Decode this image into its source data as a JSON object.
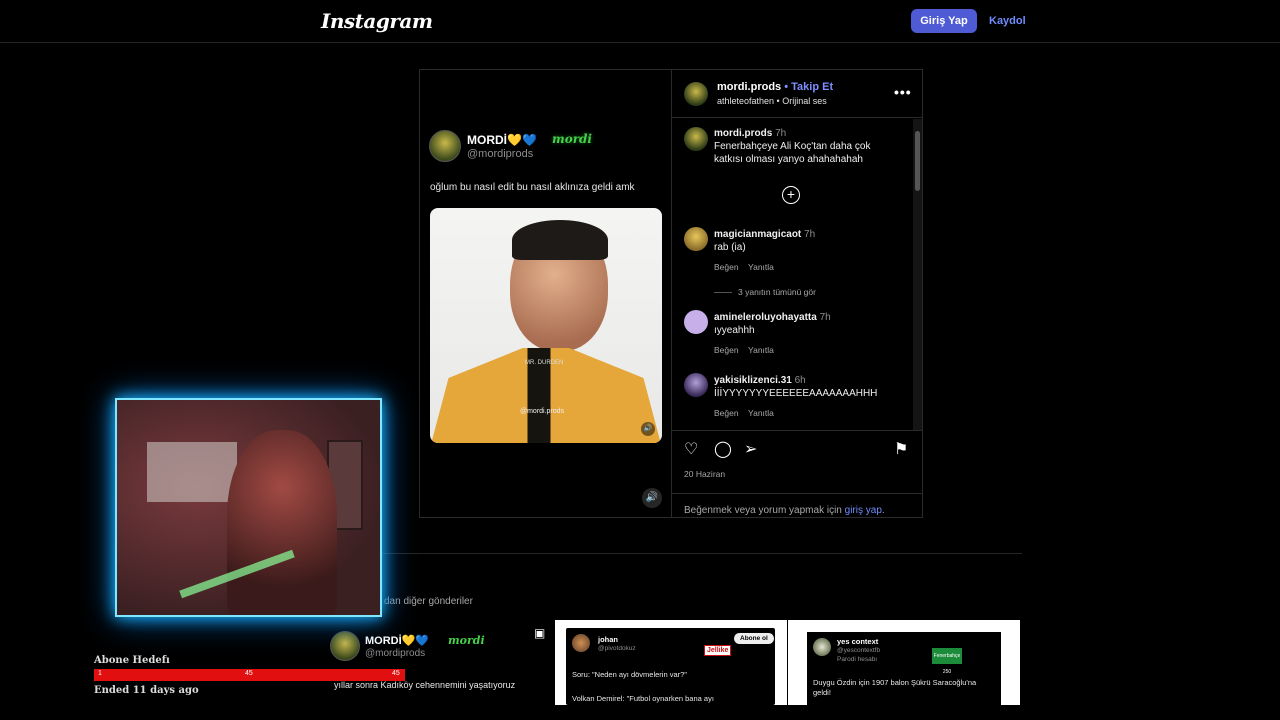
{
  "header": {
    "logo": "Instagram",
    "login_label": "Giriş Yap",
    "signup_label": "Kaydol"
  },
  "post": {
    "media": {
      "tweet_name": "MORDİ💛💙",
      "tweet_handle": "@mordiprods",
      "tweet_text": "oğlum bu nasıl edit bu nasıl aklınıza geldi amk",
      "video_tag": "MR. DURDEN",
      "video_watermark": "@mordi.prods",
      "badge": "mordi"
    },
    "author": {
      "username": "mordi.prods",
      "follow_label": "• Takip Et",
      "subline": "athleteofathen • Orijinal ses"
    },
    "caption": {
      "username": "mordi.prods",
      "time": "7h",
      "text": "Fenerbahçeye Ali Koç'tan daha çok katkısı olması yanyo ahahahahah"
    },
    "comments": [
      {
        "username": "magicianmagicaot",
        "time": "7h",
        "text": "rab (ia)",
        "like": "Beğen",
        "reply": "Yanıtla"
      },
      {
        "username": "amineleroluyohayatta",
        "time": "7h",
        "text": "ıyyeahhh",
        "like": "Beğen",
        "reply": "Yanıtla"
      },
      {
        "username": "yakisiklizenci.31",
        "time": "6h",
        "text": "İİİYYYYYYYEEEEEEAAAAAAAHHH",
        "like": "Beğen",
        "reply": "Yanıtla"
      }
    ],
    "view_replies": "3 yanıtın tümünü gör",
    "date": "20 Haziran",
    "login_prompt": "Beğenmek veya yorum yapmak için",
    "login_link": "giriş yap",
    "login_suffix": "."
  },
  "more": {
    "title": "dan diğer gönderiler",
    "cards": [
      {
        "name": "MORDİ💛💙",
        "handle": "@mordiprods",
        "badge": "mordi",
        "text": "yıllar sonra Kadıköy cehennemini yaşatıyoruz"
      },
      {
        "name": "johan",
        "handle": "@pivotdokuz",
        "pill": "Abone ol",
        "sticker": "Jellike",
        "q": "Soru: \"Neden ayı dövmelerin var?\"",
        "a": "Volkan Demirel: \"Futbol oynarken bana ayı"
      },
      {
        "name": "yes context",
        "handle": "@yescontextfb",
        "sub": "Parodi hesabı",
        "boxtext": "Fenerbahçe 250",
        "text": "Duygu Özdin için 1907 balon Şükrü Saracoğlu'na geldi!"
      }
    ]
  },
  "overlay": {
    "goal_title": "Abone Hedefı",
    "goal_left": "1",
    "goal_mid": "45",
    "goal_right": "45",
    "goal_ended": "Ended 11 days ago",
    "goal_progress": 1.0
  }
}
